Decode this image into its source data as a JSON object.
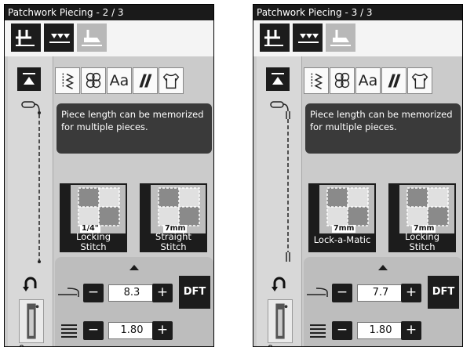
{
  "screens": [
    {
      "title": "Patchwork Piecing - 2 / 3",
      "info": {
        "line1": "Piece length can be memorized",
        "line2": "for multiple pieces."
      },
      "tiles": [
        {
          "measure": "1/4\"",
          "line1": "Locking",
          "line2": "Stitch"
        },
        {
          "measure": "7mm",
          "line1": "Straight",
          "line2": "Stitch"
        }
      ],
      "length_value": "8.3",
      "width_value": "1.80",
      "dft_label": "DFT",
      "plus": "+",
      "minus": "−",
      "aa": "Aa",
      "foot_number": "0"
    },
    {
      "title": "Patchwork Piecing - 3 / 3",
      "info": {
        "line1": "Piece length can be memorized",
        "line2": "for multiple pieces."
      },
      "tiles": [
        {
          "measure": "7mm",
          "line1": "Lock-a-Matic",
          "line2": ""
        },
        {
          "measure": "7mm",
          "line1": "Locking",
          "line2": "Stitch"
        }
      ],
      "length_value": "7.7",
      "width_value": "1.80",
      "dft_label": "DFT",
      "plus": "+",
      "minus": "−",
      "aa": "Aa",
      "foot_number": "0"
    }
  ],
  "icons": {
    "mode_buttons": [
      "stitch-mode-icon",
      "decorative-stitch-icon",
      "presser-foot-icon"
    ],
    "categories": [
      "utility-stitch-icon",
      "decorative-loop-icon",
      "letters-icon",
      "quilt-icon",
      "garment-icon"
    ]
  },
  "colors": {
    "dark": "#1c1c1c",
    "panel": "#cbcbcb",
    "info_bg": "#3a3a3a"
  }
}
